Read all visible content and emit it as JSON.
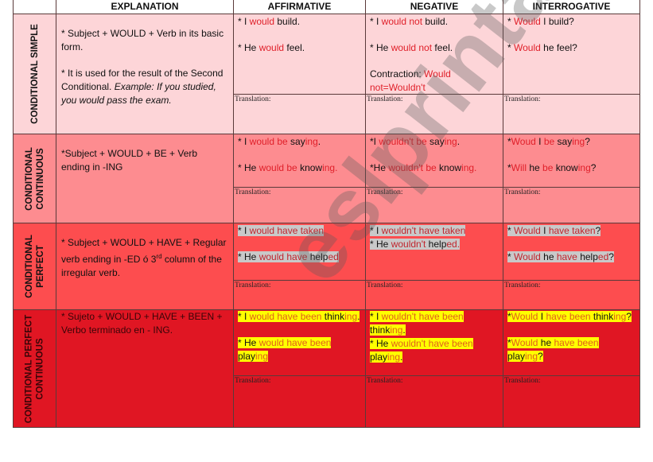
{
  "headers": {
    "blank": "",
    "explanation": "EXPLANATION",
    "affirmative": "AFFIRMATIVE",
    "negative": "NEGATIVE",
    "interrogative": "INTERROGATIVE"
  },
  "translation_label": "Translation:",
  "watermark": "eslprintables.com",
  "colors": {
    "row1_bg": "#fdd5d8",
    "row2_bg": "#fd8c90",
    "row3_bg": "#fd4d4f",
    "row4_bg": "#e01623",
    "accent_red": "#e0202a",
    "highlight_yellow": "#ffff00",
    "highlight_gray": "#c9c9c9"
  },
  "rows": [
    {
      "label_line1": "CONDITIONAL  SIMPLE",
      "label_line2": "",
      "explanation": {
        "p1": "* Subject + WOULD + Verb in its basic form.",
        "p2_plain": "* It is used for the result of the Second Conditional. ",
        "p2_italic": "Example: If you studied, you would pass the exam."
      },
      "affirmative": {
        "s1": [
          "* I ",
          "would",
          " build."
        ],
        "s2": [
          "* He ",
          "would",
          " feel."
        ]
      },
      "negative": {
        "s1": [
          "* I ",
          "would not",
          " build."
        ],
        "s2": [
          "* He ",
          "would not",
          " feel."
        ],
        "s3": [
          "Contraction: ",
          "Would not=Wouldn't"
        ]
      },
      "interrogative": {
        "s1": [
          "* ",
          "Would",
          " I build?"
        ],
        "s2": [
          "* ",
          "Would",
          " he feel?"
        ]
      }
    },
    {
      "label_line1": "CONDITIONAL",
      "label_line2": "CONTINUOUS",
      "explanation": {
        "p1": "*Subject + WOULD + BE + Verb ending in -ING"
      },
      "affirmative": {
        "s1": [
          "* I ",
          "would be",
          " say",
          "ing",
          "."
        ],
        "s2": [
          "* He ",
          "would be",
          " know",
          "ing."
        ]
      },
      "negative": {
        "s1": [
          "*I ",
          "wouldn't be",
          " say",
          "ing",
          "."
        ],
        "s2": [
          "*He ",
          "wouldn't be",
          " know",
          "ing."
        ]
      },
      "interrogative": {
        "s1": [
          "*",
          "Woud",
          " I ",
          "be",
          " say",
          "ing",
          "?"
        ],
        "s2": [
          "*",
          "Will",
          " he ",
          "be",
          " know",
          "ing",
          "?"
        ]
      }
    },
    {
      "label_line1": "CONDITIONAL",
      "label_line2": "PERFECT",
      "explanation": {
        "p1": "* Subject + WOULD + HAVE + Regular verb ending in -ED ó 3",
        "sup": "rd",
        "p1_end": " column of the irregular verb."
      },
      "affirmative": {
        "s1": [
          "* I ",
          "would have taken"
        ],
        "s2": [
          "* He ",
          "would have",
          " help",
          "ed"
        ]
      },
      "negative": {
        "s1": [
          "* I ",
          "wouldn't have taken"
        ],
        "s2": [
          "* He ",
          "wouldn't",
          " help",
          "ed."
        ]
      },
      "interrogative": {
        "s1": [
          "* ",
          "Would",
          " I ",
          "have taken",
          "?"
        ],
        "s2": [
          "* ",
          "Would",
          " he ",
          "have",
          " help",
          "ed",
          "?"
        ]
      }
    },
    {
      "label_line1": "CONDITIONAL PERFECT",
      "label_line2": "CONTINUOUS",
      "explanation": {
        "p1": "* Sujeto + WOULD + HAVE + BEEN + Verbo terminado en - ING."
      },
      "affirmative": {
        "s1": [
          "* I ",
          "would have been",
          " think",
          "ing",
          "."
        ],
        "s2": [
          "* He ",
          "would have been",
          " play",
          "ing"
        ]
      },
      "negative": {
        "s1": [
          "* I ",
          "wouldn't have been",
          " think",
          "ing",
          "."
        ],
        "s2": [
          "* He ",
          "wouldn't have been",
          " play",
          "ing",
          "."
        ]
      },
      "interrogative": {
        "s1": [
          "*",
          "Would",
          " I ",
          "have been",
          " think",
          "ing",
          "?"
        ],
        "s2": [
          "*",
          "Would",
          " he ",
          "have been",
          " play",
          "ing",
          "?"
        ]
      }
    }
  ]
}
